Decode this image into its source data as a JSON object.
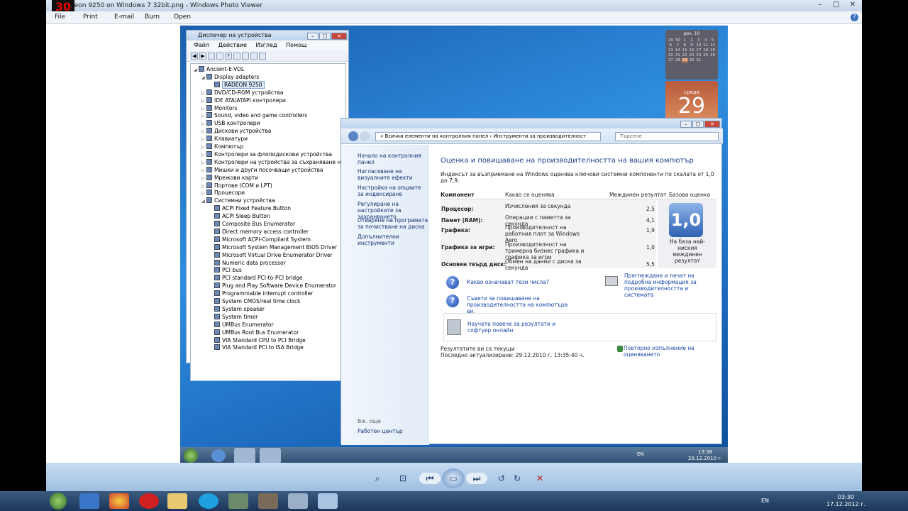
{
  "viewer": {
    "title": "deon 9250 on Windows 7 32bit.png - Windows Photo Viewer",
    "logo": "30",
    "menu": [
      "File",
      "Print",
      "E-mail",
      "Burn",
      "Open"
    ],
    "help_icon": "help-icon"
  },
  "device_manager": {
    "title": "Диспечер на устройства",
    "menu": [
      "Файл",
      "Действие",
      "Изглед",
      "Помощ"
    ],
    "tree": [
      {
        "label": "Ancient-E-VOL",
        "level": 0,
        "expanded": true
      },
      {
        "label": "Display adapters",
        "level": 1,
        "expanded": true
      },
      {
        "label": "RADEON 9250",
        "level": 2,
        "selected": true
      },
      {
        "label": "DVD/CD-ROM устройства",
        "level": 1
      },
      {
        "label": "IDE ATA/ATAPI контролери",
        "level": 1
      },
      {
        "label": "Monitors",
        "level": 1
      },
      {
        "label": "Sound, video and game controllers",
        "level": 1
      },
      {
        "label": "USB контролери",
        "level": 1
      },
      {
        "label": "Дискови устройства",
        "level": 1
      },
      {
        "label": "Клавиатури",
        "level": 1
      },
      {
        "label": "Компютър",
        "level": 1
      },
      {
        "label": "Контролери за флопидискови устройства",
        "level": 1
      },
      {
        "label": "Контролери на устройства за съхраняване на данни",
        "level": 1
      },
      {
        "label": "Мишки и други посочващи устройства",
        "level": 1
      },
      {
        "label": "Мрежови карти",
        "level": 1
      },
      {
        "label": "Портове (COM и LPT)",
        "level": 1
      },
      {
        "label": "Процесори",
        "level": 1
      },
      {
        "label": "Системни устройства",
        "level": 1,
        "expanded": true
      },
      {
        "label": "ACPI Fixed Feature Button",
        "level": 2
      },
      {
        "label": "ACPI Sleep Button",
        "level": 2
      },
      {
        "label": "Composite Bus Enumerator",
        "level": 2
      },
      {
        "label": "Direct memory access controller",
        "level": 2
      },
      {
        "label": "Microsoft ACPI-Compliant System",
        "level": 2
      },
      {
        "label": "Microsoft System Management BIOS Driver",
        "level": 2
      },
      {
        "label": "Microsoft Virtual Drive Enumerator Driver",
        "level": 2
      },
      {
        "label": "Numeric data processor",
        "level": 2
      },
      {
        "label": "PCI bus",
        "level": 2
      },
      {
        "label": "PCI standard PCI-to-PCI bridge",
        "level": 2
      },
      {
        "label": "Plug and Play Software Device Enumerator",
        "level": 2
      },
      {
        "label": "Programmable interrupt controller",
        "level": 2
      },
      {
        "label": "System CMOS/real time clock",
        "level": 2
      },
      {
        "label": "System speaker",
        "level": 2
      },
      {
        "label": "System timer",
        "level": 2
      },
      {
        "label": "UMBus Enumerator",
        "level": 2
      },
      {
        "label": "UMBus Root Bus Enumerator",
        "level": 2
      },
      {
        "label": "VIA Standard CPU to PCI Bridge",
        "level": 2
      },
      {
        "label": "VIA Standard PCI to ISA Bridge",
        "level": 2
      }
    ]
  },
  "control_panel": {
    "breadcrumb": "Всички елементи на контролния панел  ›  Инструменти за производителност",
    "search_placeholder": "Търсене",
    "sidebar": [
      "Начало на контролния панел",
      "Нагласяване на визуалните ефекти",
      "Настройка на опциите за индексиране",
      "Регулиране на настройките за захранването",
      "Отваряне на програмата за почистване на диска",
      "Допълнителни инструменти"
    ],
    "see_also": "Вж. още",
    "action_center": "Работен център",
    "heading": "Оценка и повишаване на производителността на вашия компютър",
    "intro": "Индексът за възприемане на Windows оценява ключови системни компоненти по скалата от 1,0 до 7,9.",
    "table_headers": [
      "Компонент",
      "Какво се оценява",
      "Междинен резултат",
      "Базова оценка"
    ],
    "rows": [
      {
        "component": "Процесор:",
        "what": "Изчисления за секунда",
        "score": "2,5"
      },
      {
        "component": "Памет (RAM):",
        "what": "Операции с паметта за секунда",
        "score": "4,1"
      },
      {
        "component": "Графика:",
        "what": "Производителност на работния плот за Windows Aero",
        "score": "1,9"
      },
      {
        "component": "Графика за игри:",
        "what": "Производителност на тримерна бизнес графика и графика за игри",
        "score": "1,0"
      },
      {
        "component": "Основен твърд диск:",
        "what": "Обмен на данни с диска за секунда",
        "score": "5,5"
      }
    ],
    "base_score": "1,0",
    "base_caption": "На база най-ниския междинен резултат",
    "links": [
      "Какво означават тези числа?",
      "Съвети за повишаване на производителността на компютъра ви.",
      "Научете повече за резултати и софтуер онлайн",
      "Преглеждане и печат на подробна информация за производителността и системата"
    ],
    "status1": "Резултатите ви са текущи",
    "status2": "Последно актуализиране: 29.12.2010 г. 13:35:40 ч.",
    "rerun": "Повторно изпълнение на оценяването"
  },
  "gadget": {
    "month": "дек. 10",
    "days": [
      "29",
      "30",
      "1",
      "2",
      "3",
      "4",
      "5",
      "6",
      "7",
      "8",
      "9",
      "10",
      "11",
      "12",
      "13",
      "14",
      "15",
      "16",
      "17",
      "18",
      "19",
      "20",
      "21",
      "22",
      "23",
      "24",
      "25",
      "26",
      "27",
      "28",
      "29",
      "30",
      "31"
    ],
    "weekday": "сряда",
    "day": "29"
  },
  "inner_taskbar": {
    "lang": "EN",
    "time": "13:38",
    "date": "29.12.2010 г."
  },
  "outer_taskbar": {
    "lang": "EN",
    "time": "03:30",
    "date": "17.12.2012 г."
  }
}
